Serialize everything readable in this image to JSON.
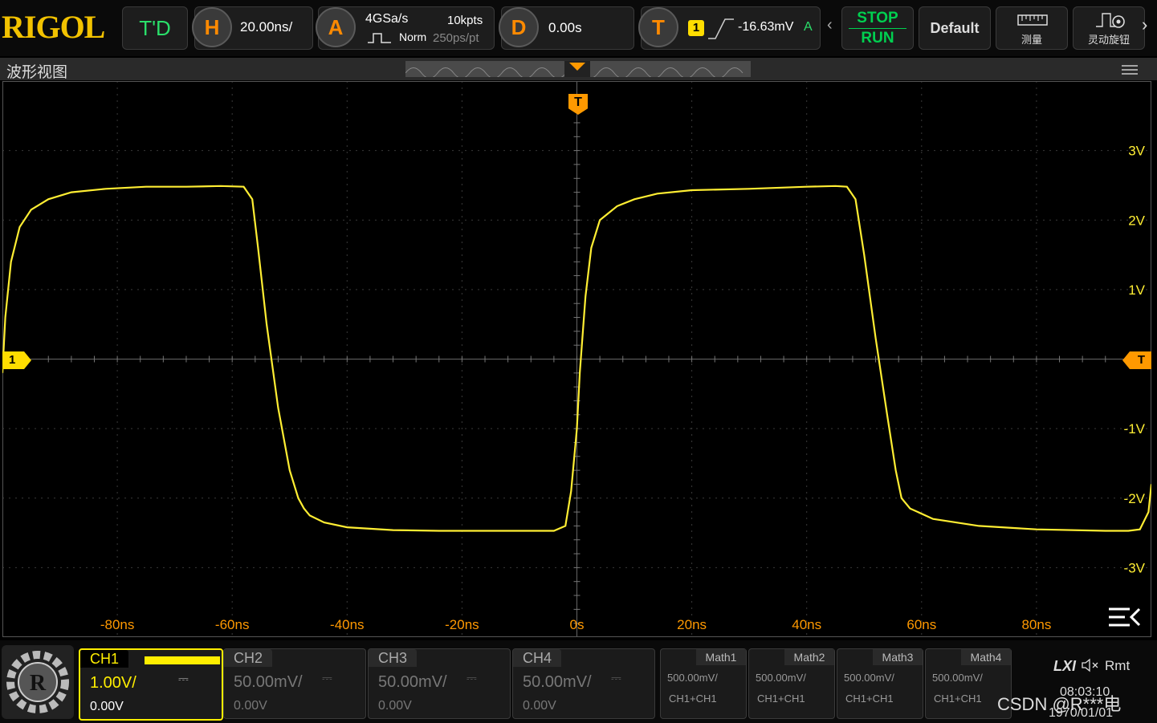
{
  "topbar": {
    "logo": "RIGOL",
    "td_label": "T'D",
    "horizontal": {
      "icon_letter": "H",
      "timebase": "20.00ns/"
    },
    "acquire": {
      "icon_letter": "A",
      "sample_rate": "4GSa/s",
      "mode": "Norm",
      "memory": "10kpts",
      "resolution": "250ps/pt"
    },
    "delay": {
      "icon_letter": "D",
      "value": "0.00s"
    },
    "trigger": {
      "icon_letter": "T",
      "source": "1",
      "level": "-16.63mV",
      "mode": "A"
    },
    "stop_label": "STOP",
    "run_label": "RUN",
    "default_label": "Default",
    "measure_label": "测量",
    "knob_label": "灵动旋钮"
  },
  "wave_view": {
    "title": "波形视图",
    "trigger_marker": "T",
    "channel_marker": "1",
    "trigger_level_marker": "T"
  },
  "axis": {
    "x_labels": [
      "-80ns",
      "-60ns",
      "-40ns",
      "-20ns",
      "0s",
      "20ns",
      "40ns",
      "60ns",
      "80ns"
    ],
    "y_labels": [
      "3V",
      "2V",
      "1V",
      "-1V",
      "-2V",
      "-3V"
    ]
  },
  "chart_data": {
    "type": "line",
    "xlabel": "",
    "ylabel": "",
    "xlim": [
      -100,
      100
    ],
    "ylim": [
      -4,
      4
    ],
    "grid": true,
    "series": [
      {
        "color": "#ffee33",
        "x": [
          -100,
          -99.5,
          -98.5,
          -97,
          -95,
          -92,
          -88,
          -82,
          -75,
          -68,
          -62,
          -58,
          -56.5,
          -55.5,
          -54,
          -52,
          -50,
          -48.5,
          -47.5,
          -46.5,
          -44,
          -40,
          -32,
          -24,
          -10,
          -4,
          -2,
          -1,
          0,
          0.5,
          1.5,
          2.5,
          4,
          7,
          10,
          14,
          20,
          30,
          40,
          45,
          47,
          48.5,
          50,
          52,
          54,
          55.5,
          56.5,
          58,
          62,
          70,
          80,
          92,
          96,
          98,
          99.5,
          100
        ],
        "y": [
          -0.2,
          0.6,
          1.4,
          1.9,
          2.15,
          2.3,
          2.4,
          2.45,
          2.48,
          2.48,
          2.49,
          2.48,
          2.3,
          1.6,
          0.5,
          -0.7,
          -1.6,
          -2.0,
          -2.15,
          -2.25,
          -2.35,
          -2.42,
          -2.46,
          -2.47,
          -2.47,
          -2.47,
          -2.4,
          -1.9,
          -1.0,
          -0.2,
          0.9,
          1.6,
          2.0,
          2.2,
          2.3,
          2.38,
          2.43,
          2.45,
          2.48,
          2.49,
          2.48,
          2.3,
          1.5,
          0.3,
          -0.8,
          -1.6,
          -2.0,
          -2.15,
          -2.3,
          -2.4,
          -2.45,
          -2.47,
          -2.47,
          -2.45,
          -2.2,
          -1.8
        ]
      }
    ]
  },
  "channels": [
    {
      "name": "CH1",
      "scale": "1.00V/",
      "offset": "0.00V",
      "color": "#ffee00",
      "active": true
    },
    {
      "name": "CH2",
      "scale": "50.00mV/",
      "offset": "0.00V",
      "color": "#7a7a7a",
      "active": false
    },
    {
      "name": "CH3",
      "scale": "50.00mV/",
      "offset": "0.00V",
      "color": "#7a7a7a",
      "active": false
    },
    {
      "name": "CH4",
      "scale": "50.00mV/",
      "offset": "0.00V",
      "color": "#7a7a7a",
      "active": false
    }
  ],
  "maths": [
    {
      "name": "Math1",
      "scale": "500.00mV/",
      "expr": "CH1+CH1"
    },
    {
      "name": "Math2",
      "scale": "500.00mV/",
      "expr": "CH1+CH1"
    },
    {
      "name": "Math3",
      "scale": "500.00mV/",
      "expr": "CH1+CH1"
    },
    {
      "name": "Math4",
      "scale": "500.00mV/",
      "expr": "CH1+CH1"
    }
  ],
  "status": {
    "lxi": "LXI",
    "remote": "Rmt",
    "time": "08:03:10",
    "date": "1970/01/01",
    "watermark": "CSDN @R***电"
  },
  "colors": {
    "trace": "#ffee33",
    "trigger": "#ff9900",
    "stop": "#00d050",
    "run": "#00d050"
  }
}
